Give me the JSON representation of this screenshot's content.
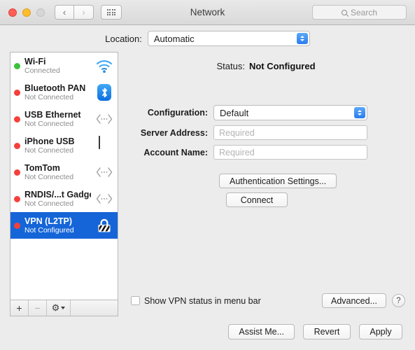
{
  "window": {
    "title": "Network",
    "traffic_lights": [
      "close",
      "minimize",
      "zoom"
    ],
    "nav_back_icon": "chevron-left-icon",
    "nav_forward_icon": "chevron-right-icon",
    "grid_icon": "all-preferences-grid-icon",
    "search": {
      "placeholder": "Search",
      "value": "",
      "icon": "search-icon"
    }
  },
  "location": {
    "label": "Location:",
    "value": "Automatic",
    "options": [
      "Automatic"
    ]
  },
  "sidebar": {
    "services": [
      {
        "name": "Wi-Fi",
        "status": "Connected",
        "dot": "green",
        "icon": "wifi-icon",
        "selected": false
      },
      {
        "name": "Bluetooth PAN",
        "status": "Not Connected",
        "dot": "red",
        "icon": "bluetooth-icon",
        "selected": false
      },
      {
        "name": "USB Ethernet",
        "status": "Not Connected",
        "dot": "red",
        "icon": "ethernet-icon",
        "selected": false
      },
      {
        "name": "iPhone USB",
        "status": "Not Connected",
        "dot": "red",
        "icon": "iphone-icon",
        "selected": false
      },
      {
        "name": "TomTom",
        "status": "Not Connected",
        "dot": "red",
        "icon": "ethernet-icon",
        "selected": false
      },
      {
        "name": "RNDIS/...t Gadget",
        "status": "Not Connected",
        "dot": "red",
        "icon": "ethernet-icon",
        "selected": false
      },
      {
        "name": "VPN (L2TP)",
        "status": "Not Configured",
        "dot": "red",
        "icon": "vpn-lock-icon",
        "selected": true
      }
    ],
    "toolbar": {
      "add_label": "+",
      "remove_label": "−",
      "gear_label": "⚙",
      "add_icon": "plus-icon",
      "remove_icon": "minus-icon",
      "gear_icon": "gear-icon",
      "gear_caret_icon": "chevron-down-icon"
    }
  },
  "panel": {
    "status_label": "Status:",
    "status_value": "Not Configured",
    "fields": [
      {
        "label": "Configuration:",
        "type": "popup",
        "value": "Default"
      },
      {
        "label": "Server Address:",
        "type": "text",
        "value": "",
        "placeholder": "Required"
      },
      {
        "label": "Account Name:",
        "type": "text",
        "value": "",
        "placeholder": "Required"
      }
    ],
    "auth_settings_label": "Authentication Settings...",
    "connect_label": "Connect",
    "show_status_label": "Show VPN status in menu bar",
    "show_status_checked": false,
    "advanced_label": "Advanced...",
    "help_label": "?"
  },
  "footer": {
    "assist_label": "Assist Me...",
    "revert_label": "Revert",
    "apply_label": "Apply"
  },
  "colors": {
    "selection_blue": "#1565d8",
    "stepper_blue": "#2b7cf0",
    "status_green": "#3ec13e",
    "status_red": "#f5403a",
    "window_bg": "#ececec"
  }
}
